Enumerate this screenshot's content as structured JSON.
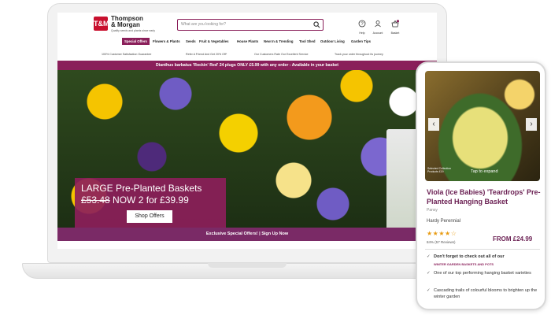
{
  "site": {
    "brand_line1": "Thompson",
    "brand_line2": "& Morgan",
    "tagline": "Quality seeds and plants since early",
    "logo_mark": "T&M"
  },
  "search": {
    "placeholder": "What are you looking for?"
  },
  "header_icons": {
    "help": "Help",
    "account": "Account",
    "basket": "Basket",
    "basket_count": "0"
  },
  "nav": {
    "items": [
      "Special Offers",
      "Flowers & Plants",
      "Seeds",
      "Fruit & Vegetables",
      "House Plants",
      "New In & Trending",
      "Tool Shed",
      "Outdoor Living",
      "Garden Tips"
    ]
  },
  "benefits": {
    "items": [
      "100% Customer Satisfaction Guarantee",
      "Refer A Friend And Get 20% Off*",
      "Our Customers Rate Our Excellent Service",
      "Track your order throughout its journey"
    ]
  },
  "promo_bar": "Dianthus barbatus 'Rockin' Red' 24 plugs ONLY £5.99 with any order - Available in your basket",
  "hero": {
    "line1": "LARGE Pre-Planted Baskets",
    "old_price": "£53.48",
    "line2_rest": "NOW 2 for £39.99",
    "button": "Shop Offers"
  },
  "signup_bar": "Exclusive Special Offers! | Sign Up Now",
  "phone": {
    "image_caption_line1": "Selected Collection",
    "image_caption_line2": "Products £19",
    "tap_to_expand": "Tap to expand",
    "title": "Viola (Ice Babies) 'Teardrops' Pre-Planted Hanging Basket",
    "subtitle": "Pansy",
    "hardiness": "Hardy Perennial",
    "stars": "★★★★☆",
    "rating_text": "84% (57 Reviews)",
    "price": "FROM £24.99",
    "bullets": [
      "Don't forget to check out all of our",
      "One of our top performing hanging basket varieties",
      "Cascading trails of colourful blooms to brighten up the winter garden"
    ],
    "bullet1_link": "WINTER GARDEN BASKETS AND POTS",
    "check": "✓"
  },
  "colors": {
    "brand_plum": "#8a1f5a",
    "logo_red": "#c8102e",
    "star_orange": "#e89c14"
  },
  "icons": [
    "search-icon",
    "help-icon",
    "account-icon",
    "basket-icon",
    "chevron-left-icon",
    "chevron-right-icon",
    "check-icon"
  ]
}
